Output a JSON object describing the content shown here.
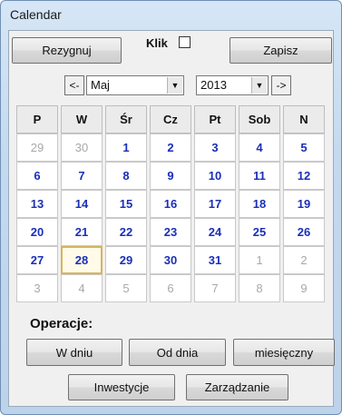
{
  "window": {
    "title": "Calendar"
  },
  "toolbar": {
    "cancel_label": "Rezygnuj",
    "klik_label": "Klik",
    "klik_checked": false,
    "save_label": "Zapisz"
  },
  "nav": {
    "prev_label": "<-",
    "next_label": "->",
    "month": "Maj",
    "year": "2013"
  },
  "calendar": {
    "weekdays": [
      "P",
      "W",
      "Śr",
      "Cz",
      "Pt",
      "Sob",
      "N"
    ],
    "weeks": [
      [
        {
          "d": "29",
          "m": "other"
        },
        {
          "d": "30",
          "m": "other"
        },
        {
          "d": "1",
          "m": "cur"
        },
        {
          "d": "2",
          "m": "cur"
        },
        {
          "d": "3",
          "m": "cur"
        },
        {
          "d": "4",
          "m": "cur"
        },
        {
          "d": "5",
          "m": "cur"
        }
      ],
      [
        {
          "d": "6",
          "m": "cur"
        },
        {
          "d": "7",
          "m": "cur"
        },
        {
          "d": "8",
          "m": "cur"
        },
        {
          "d": "9",
          "m": "cur"
        },
        {
          "d": "10",
          "m": "cur"
        },
        {
          "d": "11",
          "m": "cur"
        },
        {
          "d": "12",
          "m": "cur"
        }
      ],
      [
        {
          "d": "13",
          "m": "cur"
        },
        {
          "d": "14",
          "m": "cur"
        },
        {
          "d": "15",
          "m": "cur"
        },
        {
          "d": "16",
          "m": "cur"
        },
        {
          "d": "17",
          "m": "cur"
        },
        {
          "d": "18",
          "m": "cur"
        },
        {
          "d": "19",
          "m": "cur"
        }
      ],
      [
        {
          "d": "20",
          "m": "cur"
        },
        {
          "d": "21",
          "m": "cur"
        },
        {
          "d": "22",
          "m": "cur"
        },
        {
          "d": "23",
          "m": "cur"
        },
        {
          "d": "24",
          "m": "cur"
        },
        {
          "d": "25",
          "m": "cur"
        },
        {
          "d": "26",
          "m": "cur"
        }
      ],
      [
        {
          "d": "27",
          "m": "cur"
        },
        {
          "d": "28",
          "m": "today"
        },
        {
          "d": "29",
          "m": "cur"
        },
        {
          "d": "30",
          "m": "cur"
        },
        {
          "d": "31",
          "m": "cur"
        },
        {
          "d": "1",
          "m": "other"
        },
        {
          "d": "2",
          "m": "other"
        }
      ],
      [
        {
          "d": "3",
          "m": "other"
        },
        {
          "d": "4",
          "m": "other"
        },
        {
          "d": "5",
          "m": "other"
        },
        {
          "d": "6",
          "m": "other"
        },
        {
          "d": "7",
          "m": "other"
        },
        {
          "d": "8",
          "m": "other"
        },
        {
          "d": "9",
          "m": "other"
        }
      ]
    ]
  },
  "operations": {
    "label": "Operacje:",
    "w_dniu": "W dniu",
    "od_dnia": "Od dnia",
    "miesieczny": "miesięczny",
    "inwestycje": "Inwestycje",
    "zarzadzanie": "Zarządzanie"
  }
}
